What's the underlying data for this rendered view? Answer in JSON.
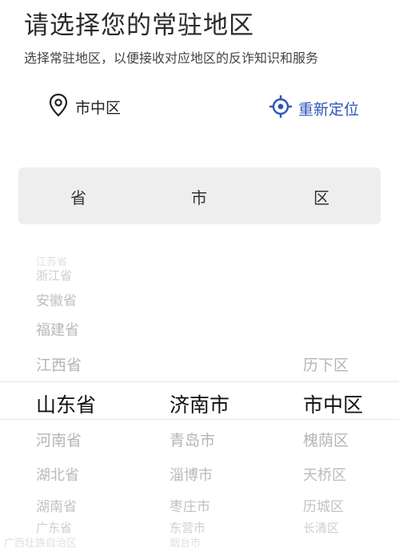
{
  "header": {
    "title": "请选择您的常驻地区",
    "subtitle": "选择常驻地区，以便接收对应地区的反诈知识和服务"
  },
  "location": {
    "current": "市中区",
    "relocate_label": "重新定位",
    "accent": "#2d55b8"
  },
  "columns": {
    "province": "省",
    "city": "市",
    "district": "区"
  },
  "picker": {
    "provinces": [
      "江苏省",
      "浙江省",
      "安徽省",
      "福建省",
      "江西省",
      "山东省",
      "河南省",
      "湖北省",
      "湖南省",
      "广东省",
      "广西壮族自治区"
    ],
    "cities": [
      "济南市",
      "青岛市",
      "淄博市",
      "枣庄市",
      "东营市",
      "烟台市"
    ],
    "districts": [
      "历下区",
      "市中区",
      "槐荫区",
      "天桥区",
      "历城区",
      "长清区"
    ],
    "selected": {
      "province": "山东省",
      "city": "济南市",
      "district": "市中区"
    }
  }
}
